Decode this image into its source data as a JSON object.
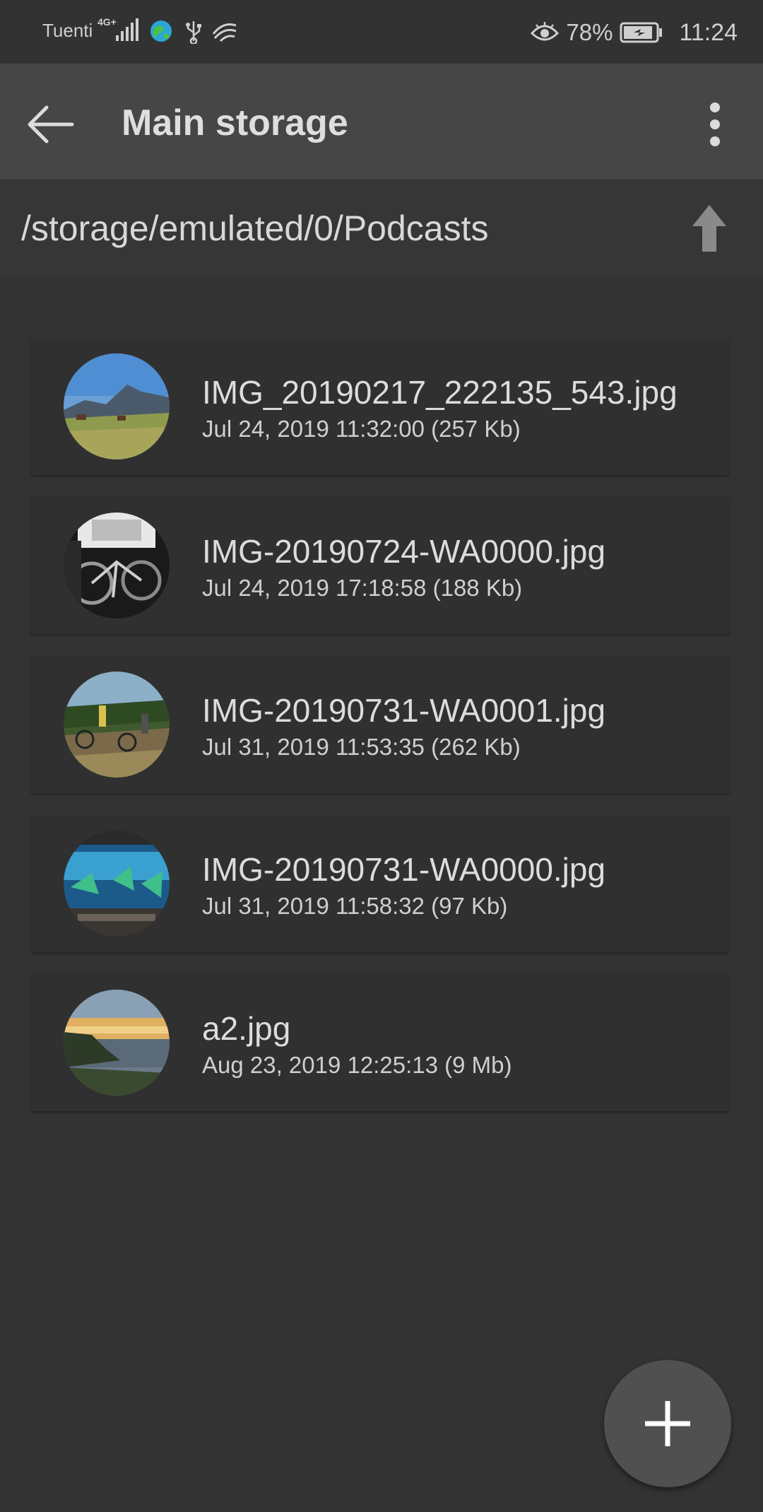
{
  "status_bar": {
    "carrier": "Tuenti",
    "network_type": "4G+",
    "battery_percent": "78%",
    "time": "11:24",
    "icons": [
      "signal-icon",
      "globe-icon",
      "usb-icon",
      "swiftkey-icon",
      "eye-icon",
      "battery-icon"
    ]
  },
  "app_bar": {
    "title": "Main storage",
    "back_icon": "arrow-left-icon",
    "menu_icon": "more-vert-icon"
  },
  "path_bar": {
    "path": "/storage/emulated/0/Podcasts",
    "up_icon": "arrow-up-icon"
  },
  "files": [
    {
      "name": "IMG_20190217_222135_543.jpg",
      "meta": "Jul 24, 2019 11:32:00 (257 Kb)",
      "thumb": "mountain-landscape"
    },
    {
      "name": "IMG-20190724-WA0000.jpg",
      "meta": "Jul 24, 2019 17:18:58 (188 Kb)",
      "thumb": "bicycles-in-car"
    },
    {
      "name": "IMG-20190731-WA0001.jpg",
      "meta": "Jul 31, 2019 11:53:35 (262 Kb)",
      "thumb": "bikers-on-trail"
    },
    {
      "name": "IMG-20190731-WA0000.jpg",
      "meta": "Jul 31, 2019 11:58:32 (97 Kb)",
      "thumb": "aquarium"
    },
    {
      "name": "a2.jpg",
      "meta": "Aug 23, 2019 12:25:13 (9 Mb)",
      "thumb": "coastal-sunset"
    }
  ],
  "fab": {
    "icon": "plus-icon"
  }
}
